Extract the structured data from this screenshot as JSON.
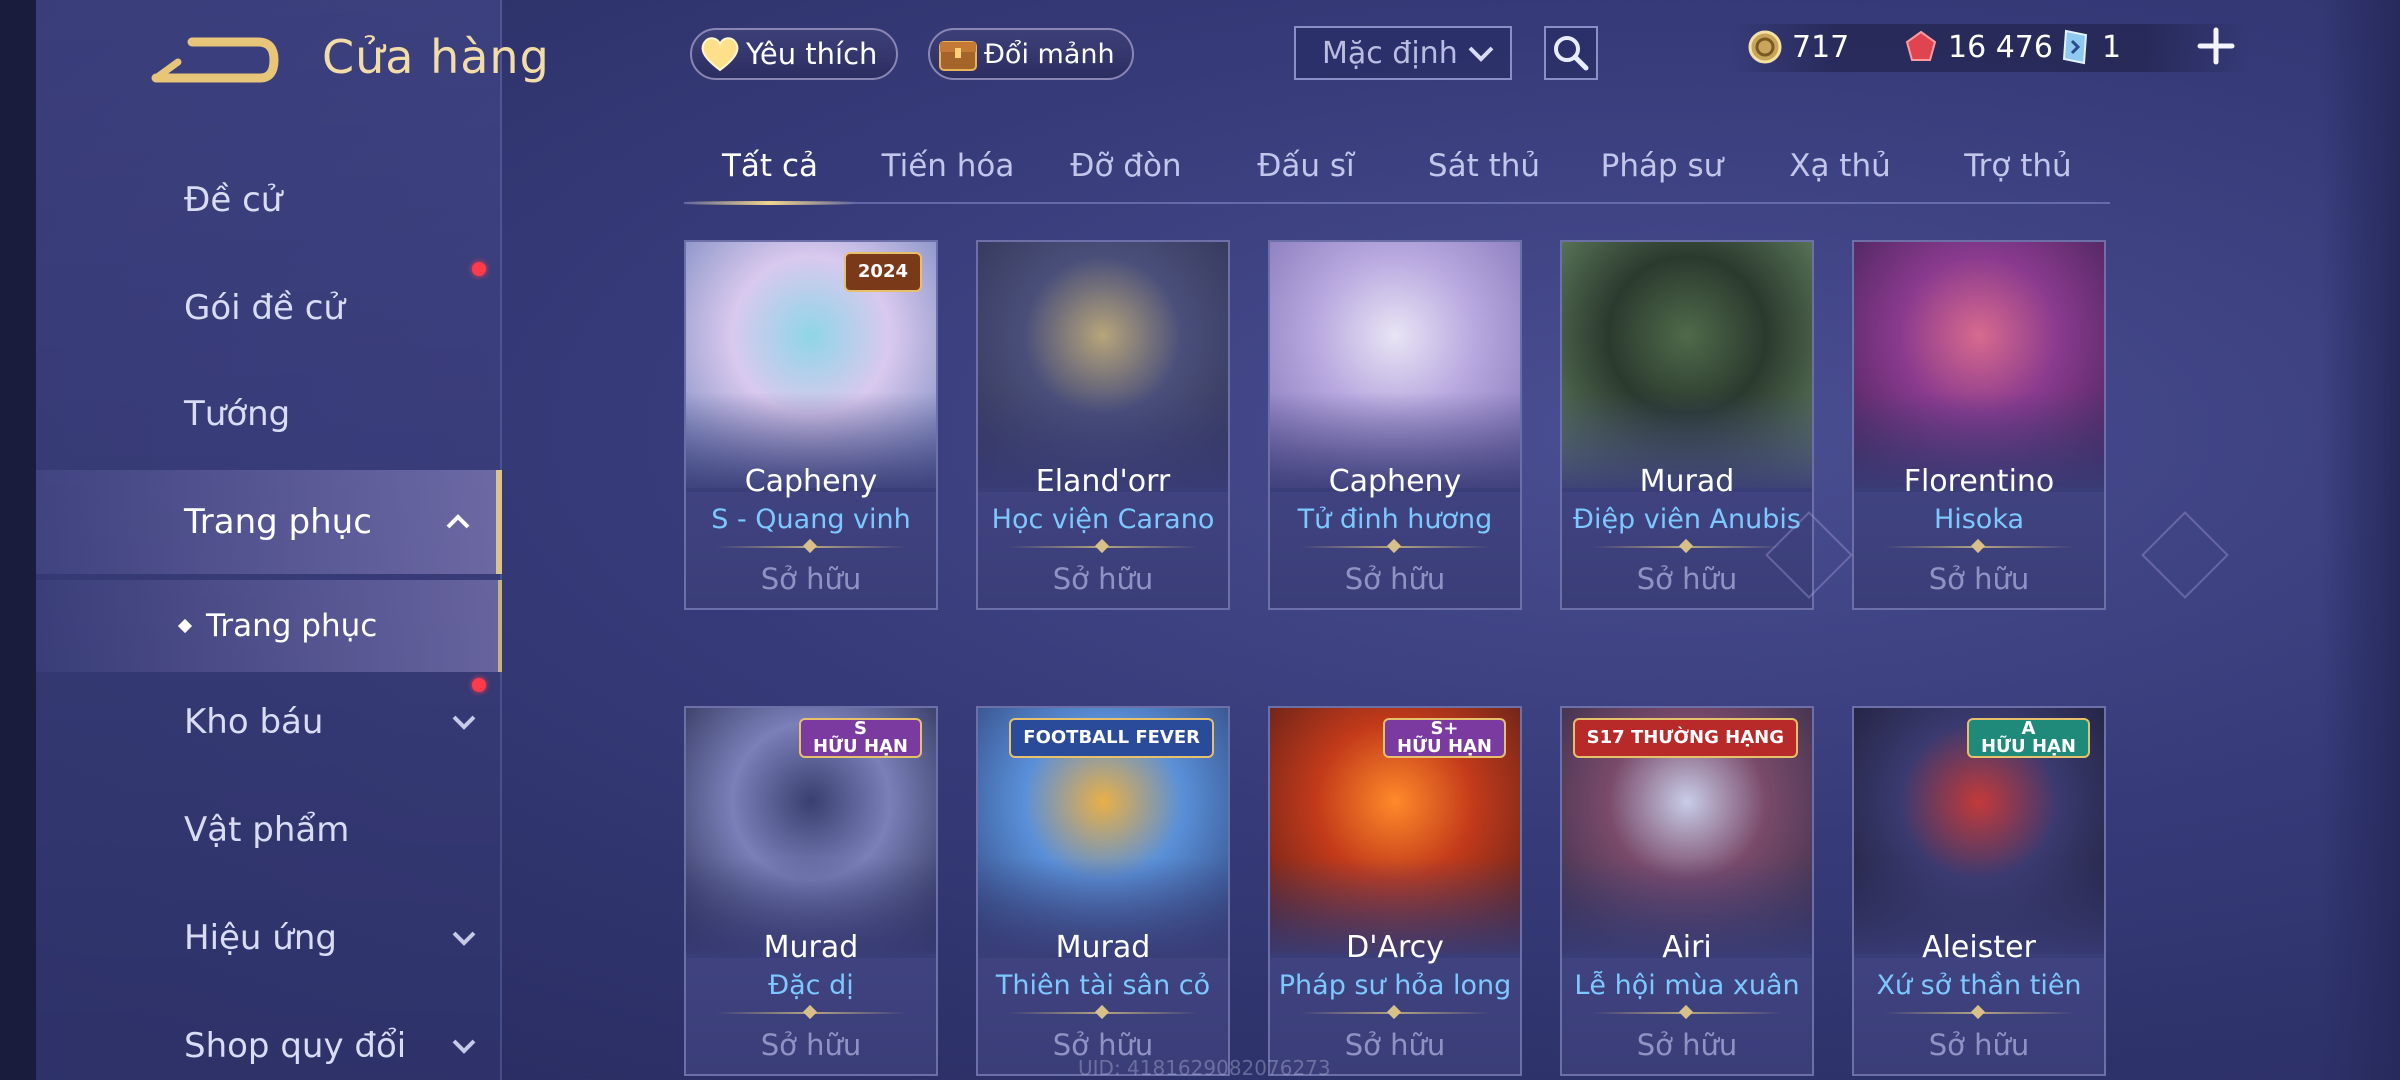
{
  "header": {
    "title": "Cửa hàng",
    "favorites_label": "Yêu thích",
    "exchange_label": "Đổi mảnh",
    "sort": {
      "selected": "Mặc định"
    },
    "currencies": [
      {
        "icon": "gold-coin-icon",
        "value": "717"
      },
      {
        "icon": "red-voucher-icon",
        "value": "16 476"
      },
      {
        "icon": "blue-ticket-icon",
        "value": "1"
      }
    ]
  },
  "sidebar": {
    "items": [
      {
        "label": "Đề cử"
      },
      {
        "label": "Gói đề cử"
      },
      {
        "label": "Tướng"
      },
      {
        "label": "Trang phục"
      },
      {
        "label": "Trang phục"
      },
      {
        "label": "Kho báu"
      },
      {
        "label": "Vật phẩm"
      },
      {
        "label": "Hiệu ứng"
      },
      {
        "label": "Shop quy đổi"
      }
    ]
  },
  "tabs": [
    {
      "label": "Tất cả"
    },
    {
      "label": "Tiến hóa"
    },
    {
      "label": "Đỡ đòn"
    },
    {
      "label": "Đấu sĩ"
    },
    {
      "label": "Sát thủ"
    },
    {
      "label": "Pháp sư"
    },
    {
      "label": "Xạ thủ"
    },
    {
      "label": "Trợ thủ"
    }
  ],
  "skins": [
    {
      "hero": "Capheny",
      "skin": "S - Quang vinh",
      "status": "Sở hữu",
      "badge": "2024",
      "palette": [
        "#8fd6e8",
        "#d9c9ee",
        "#6a7fb8"
      ]
    },
    {
      "hero": "Eland'orr",
      "skin": "Học viện Carano",
      "status": "Sở hữu",
      "badge": "",
      "palette": [
        "#b7a57a",
        "#4a4f7a",
        "#2d3050"
      ]
    },
    {
      "hero": "Capheny",
      "skin": "Tử đinh hương",
      "status": "Sở hữu",
      "badge": "",
      "palette": [
        "#e8e4f4",
        "#b9a9e0",
        "#7a6cb0"
      ]
    },
    {
      "hero": "Murad",
      "skin": "Điệp viên Anubis",
      "status": "Sở hữu",
      "badge": "",
      "palette": [
        "#4f6a4a",
        "#2b3a2e",
        "#6e8f6a"
      ]
    },
    {
      "hero": "Florentino",
      "skin": "Hisoka",
      "status": "Sở hữu",
      "badge": "",
      "palette": [
        "#d86a8e",
        "#8a3a8e",
        "#3a2050"
      ]
    },
    {
      "hero": "Murad",
      "skin": "Đặc dị",
      "status": "Sở hữu",
      "badge": "S\nHỮU HẠN",
      "palette": [
        "#3a3f70",
        "#7a80b8",
        "#1e2244"
      ]
    },
    {
      "hero": "Murad",
      "skin": "Thiên tài sân cỏ",
      "status": "Sở hữu",
      "badge": "FOOTBALL FEVER",
      "palette": [
        "#e8b048",
        "#5a90d8",
        "#2a3a70"
      ]
    },
    {
      "hero": "D'Arcy",
      "skin": "Pháp sư hỏa long",
      "status": "Sở hữu",
      "badge": "S+\nHỮU HẠN",
      "palette": [
        "#ff8a2a",
        "#c23a1a",
        "#4a1a1a"
      ]
    },
    {
      "hero": "Airi",
      "skin": "Lễ hội mùa xuân",
      "status": "Sở hữu",
      "badge": "S17 THƯỜNG HẠNG",
      "palette": [
        "#c8cde8",
        "#7a4a6a",
        "#2a2a44"
      ]
    },
    {
      "hero": "Aleister",
      "skin": "Xứ sở thần tiên",
      "status": "Sở hữu",
      "badge": "A\nHỮU HẠN",
      "palette": [
        "#c23a3a",
        "#3a3a70",
        "#1a1a30"
      ]
    }
  ],
  "footer": {
    "uid": "UID: 4181629082076273"
  },
  "colors": {
    "accent_gold": "#f0d58e",
    "skin_name_blue": "#7cc8ff",
    "notification_red": "#ff3b4b"
  }
}
